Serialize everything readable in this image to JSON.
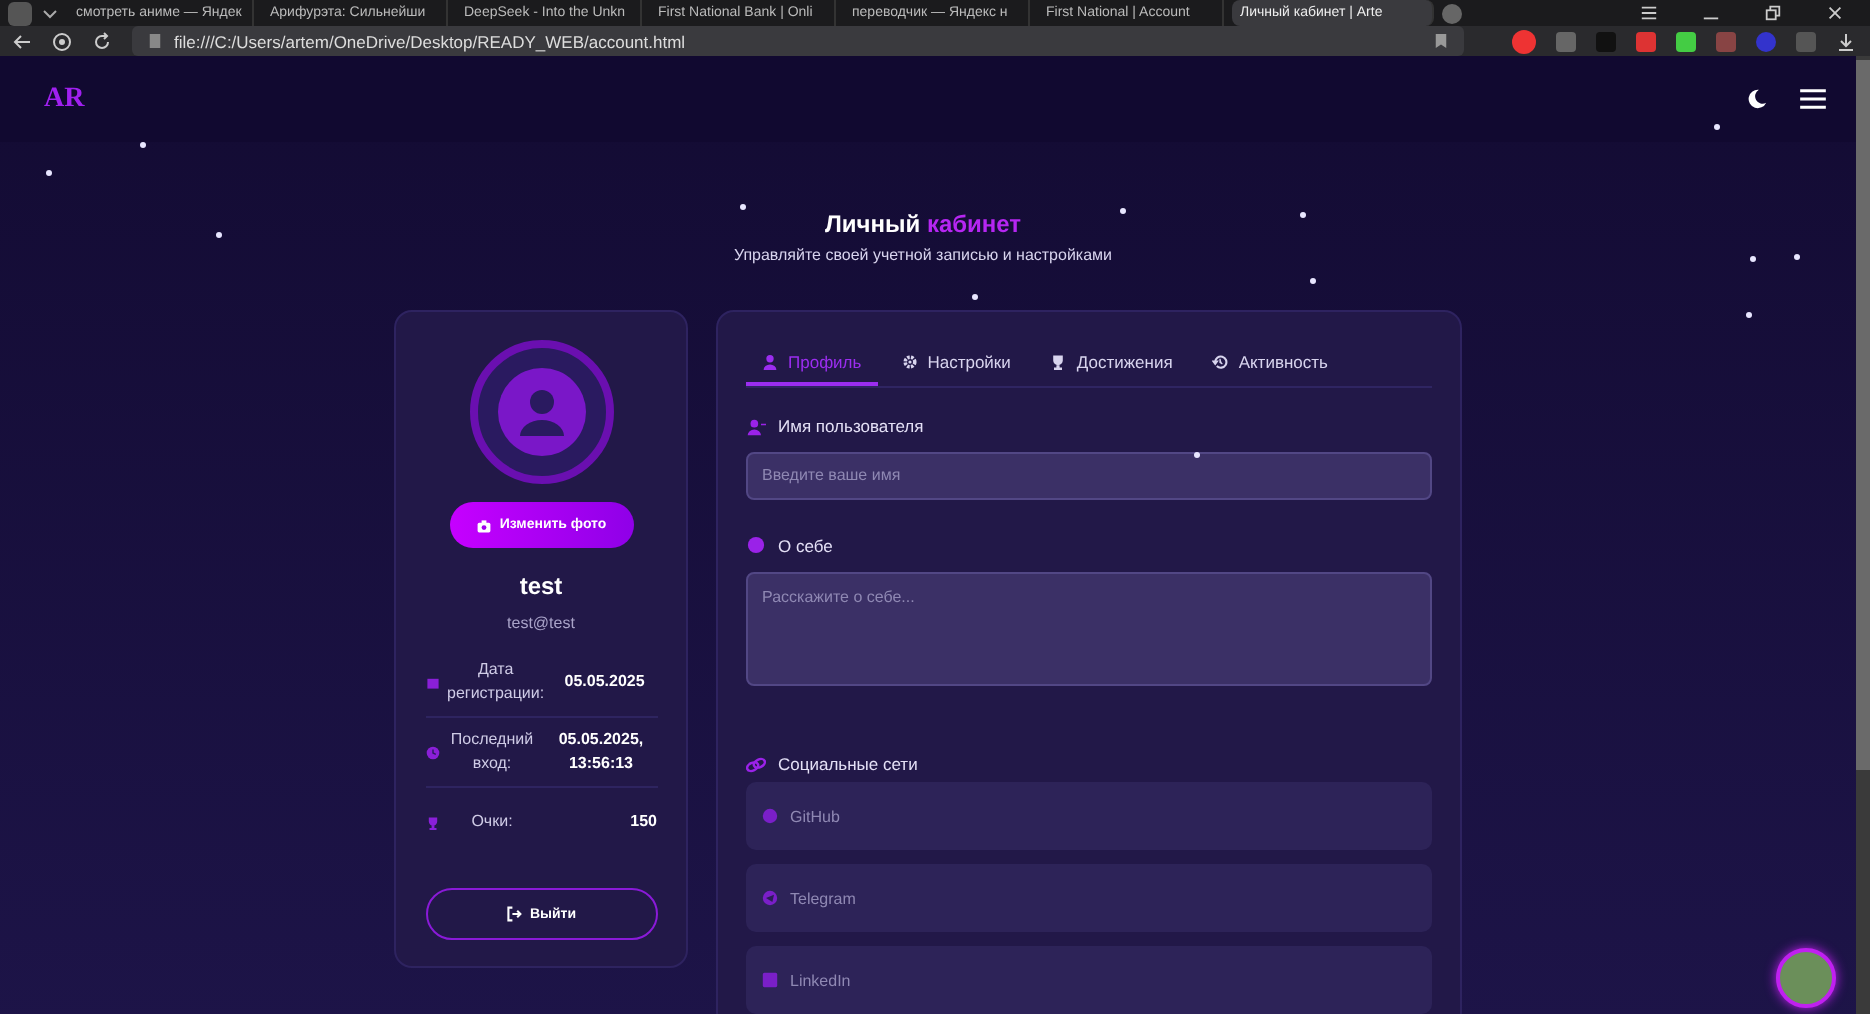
{
  "browser": {
    "tabs": [
      {
        "title": "смотреть аниме — Яндек",
        "selected": false
      },
      {
        "title": "Арифурэта: Сильнейши",
        "selected": false
      },
      {
        "title": "DeepSeek - Into the Unkn",
        "selected": false
      },
      {
        "title": "First National Bank | Onli",
        "selected": false
      },
      {
        "title": "переводчик — Яндекс н",
        "selected": false
      },
      {
        "title": "First National | Account",
        "selected": false
      },
      {
        "title": "Личный кабинет | Arte",
        "selected": true
      }
    ],
    "address": "file:///C:/Users/artem/OneDrive/Desktop/READY_WEB/account.html"
  },
  "header": {
    "logo": "AR"
  },
  "page": {
    "title": "Личный",
    "title_accent": "кабинет",
    "subtitle": "Управляйте своей учетной записью и настройками"
  },
  "profile": {
    "change_photo": "Изменить фото",
    "username": "test",
    "email": "test@test",
    "stats": [
      {
        "kind": "calendar",
        "label": "Дата регистрации:",
        "value": "05.05.2025"
      },
      {
        "kind": "clock",
        "label": "Последний вход:",
        "value": "05.05.2025, 13:56:13"
      },
      {
        "kind": "trophy",
        "label": "Очки:",
        "value": "150"
      }
    ],
    "logout": "Выйти"
  },
  "tabs": [
    {
      "kind": "user",
      "label": "Профиль",
      "selected": true
    },
    {
      "kind": "gear",
      "label": "Настройки",
      "selected": false
    },
    {
      "kind": "trophy",
      "label": "Достижения",
      "selected": false
    },
    {
      "kind": "history",
      "label": "Активность",
      "selected": false
    }
  ],
  "form": {
    "fields": [
      {
        "kind": "input",
        "label": "Имя пользователя",
        "placeholder": "Введите ваше имя"
      },
      {
        "kind": "textarea",
        "label": "О себе",
        "placeholder": "Расскажите о себе..."
      }
    ],
    "social": {
      "label": "Социальные сети",
      "links": [
        {
          "kind": "github",
          "placeholder": "GitHub"
        },
        {
          "kind": "telegram",
          "placeholder": "Telegram"
        },
        {
          "kind": "linkedin",
          "placeholder": "LinkedIn"
        }
      ]
    }
  }
}
